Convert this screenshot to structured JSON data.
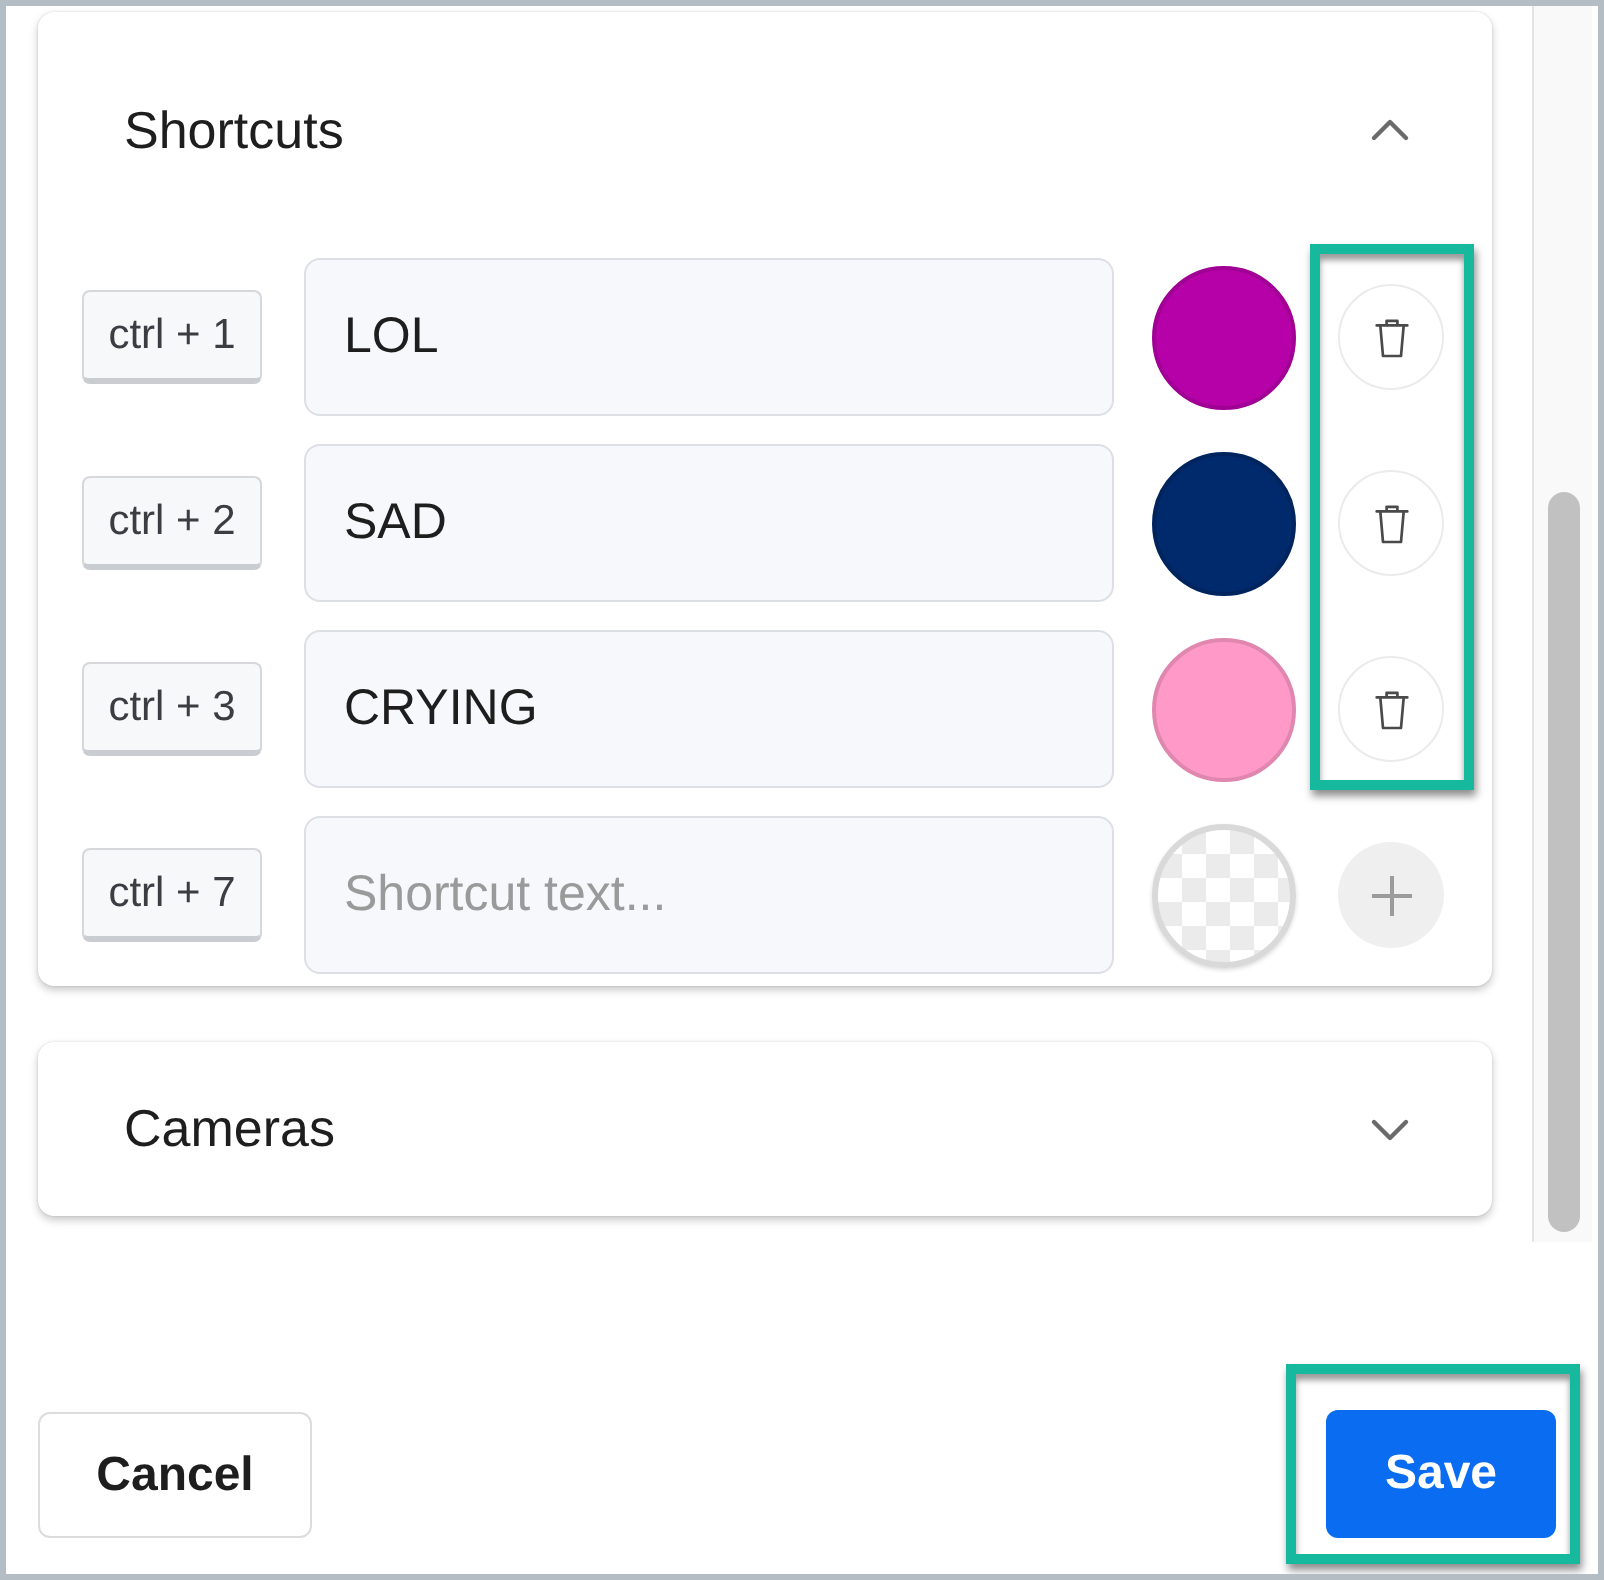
{
  "sections": [
    {
      "title": "Shortcuts",
      "expanded": true,
      "delete_highlighted": true,
      "shortcuts": [
        {
          "key": "ctrl + 1",
          "text": "LOL",
          "color": "#b600a8"
        },
        {
          "key": "ctrl + 2",
          "text": "SAD",
          "color": "#002a6b"
        },
        {
          "key": "ctrl + 3",
          "text": "CRYING",
          "color": "#ff99c8"
        }
      ],
      "new_shortcut": {
        "key": "ctrl + 7",
        "placeholder": "Shortcut text..."
      }
    },
    {
      "title": "Cameras",
      "expanded": false
    }
  ],
  "footer": {
    "cancel": {
      "label": "Cancel"
    },
    "save": {
      "label": "Save",
      "highlighted": true
    }
  }
}
